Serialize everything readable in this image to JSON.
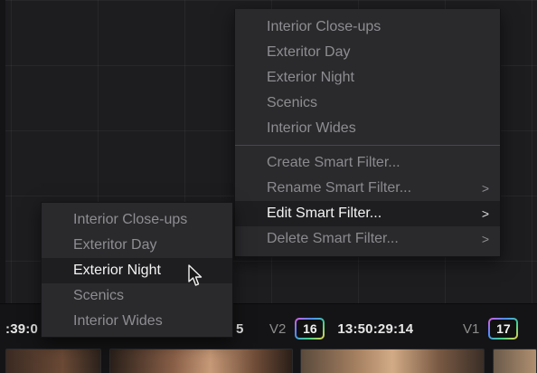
{
  "main_menu": {
    "filters": [
      "Interior Close-ups",
      "Exteritor Day",
      "Exterior Night",
      "Scenics",
      "Interior Wides"
    ],
    "actions": [
      {
        "label": "Create Smart Filter...",
        "submenu": false
      },
      {
        "label": "Rename Smart Filter...",
        "submenu": true
      },
      {
        "label": "Edit Smart Filter...",
        "submenu": true,
        "highlighted": true
      },
      {
        "label": "Delete Smart Filter...",
        "submenu": true
      }
    ]
  },
  "sub_menu": {
    "items": [
      "Interior Close-ups",
      "Exteritor Day",
      "Exterior Night",
      "Scenics",
      "Interior Wides"
    ],
    "highlighted": "Exterior Night"
  },
  "clip_strip": {
    "clip_a_timecode_fragment": ":39:0",
    "clip_b_track_fragment": "5",
    "clip_c": {
      "track": "V2",
      "badge": "16",
      "timecode": "13:50:29:14"
    },
    "clip_d": {
      "track": "V1",
      "badge": "17"
    }
  },
  "icons": {
    "submenu_arrow": "chevron-right-icon",
    "pointer": "mouse-pointer-icon"
  },
  "colors": {
    "menu_bg": "#2a2a2d",
    "highlight_bg": "#1e1e21",
    "badge_gradient": [
      "#e45bd6",
      "#4e8cff",
      "#43d38a",
      "#f3d34a"
    ]
  }
}
